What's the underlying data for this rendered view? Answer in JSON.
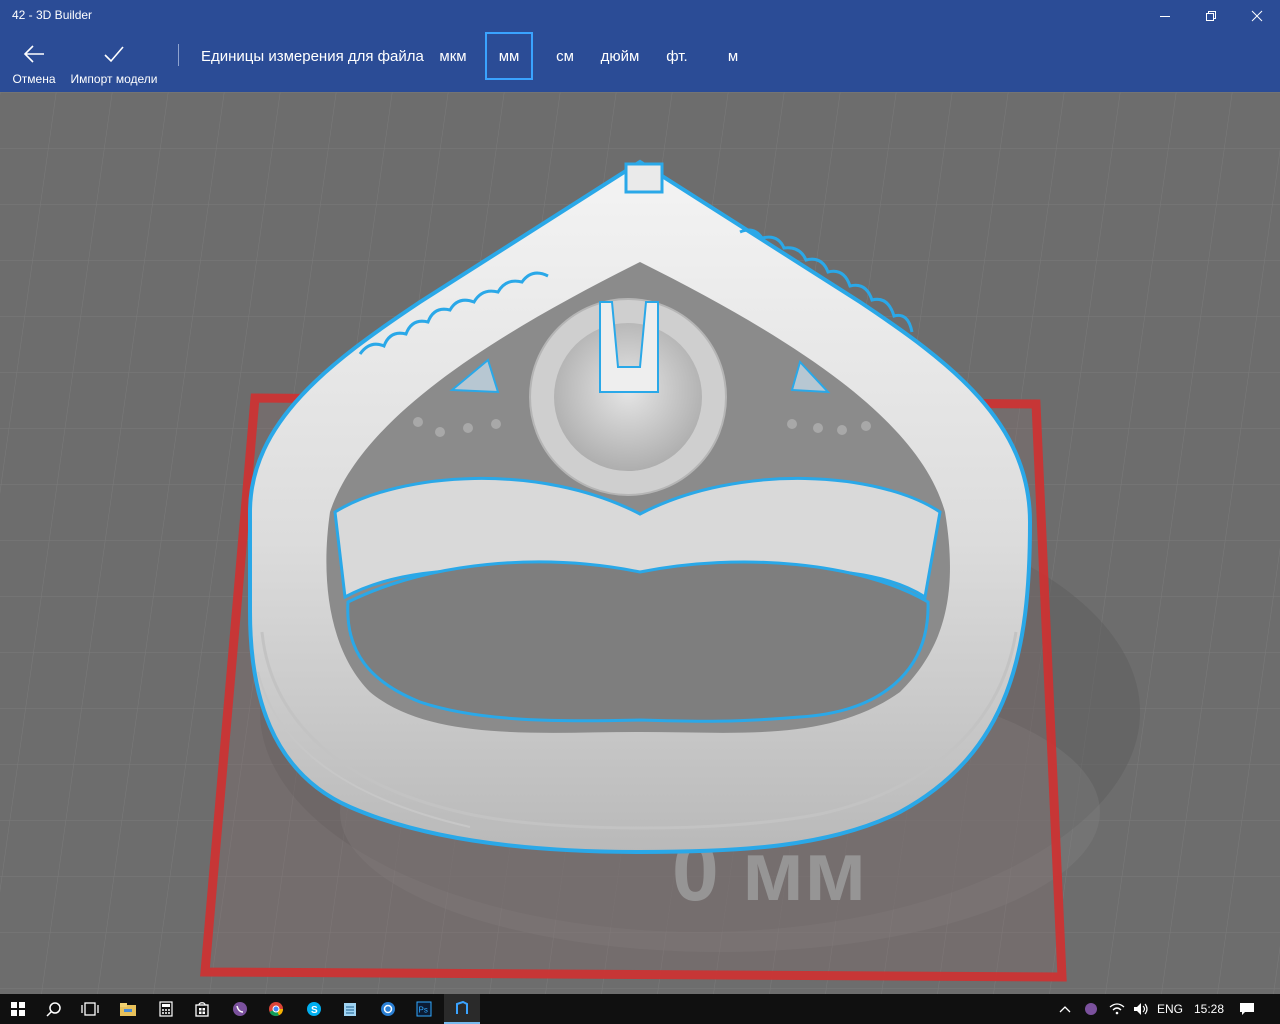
{
  "window": {
    "title": "42 - 3D Builder",
    "minimize_icon": "minimize-icon",
    "restore_icon": "restore-icon",
    "close_icon": "close-icon"
  },
  "commandbar": {
    "cancel": {
      "label": "Отмена",
      "icon": "back-arrow-icon"
    },
    "import": {
      "label": "Импорт модели",
      "icon": "checkmark-icon"
    },
    "units_label": "Единицы измерения для файла",
    "units": [
      "мкм",
      "мм",
      "см",
      "дюйм",
      "фт.",
      "м"
    ],
    "selected_unit": "мм"
  },
  "viewport": {
    "floor_label": "0 мм",
    "accent": "#2aa8e8",
    "bounds_color": "#d03030"
  },
  "taskbar": {
    "apps": [
      "start-icon",
      "search-icon",
      "task-view-icon",
      "file-explorer-icon",
      "calculator-icon",
      "store-icon",
      "viber-icon",
      "chrome-icon",
      "skype-icon",
      "notepad-icon",
      "settings-app-icon",
      "photoshop-icon",
      "3d-builder-icon"
    ],
    "language": "ENG",
    "time": "15:28"
  }
}
